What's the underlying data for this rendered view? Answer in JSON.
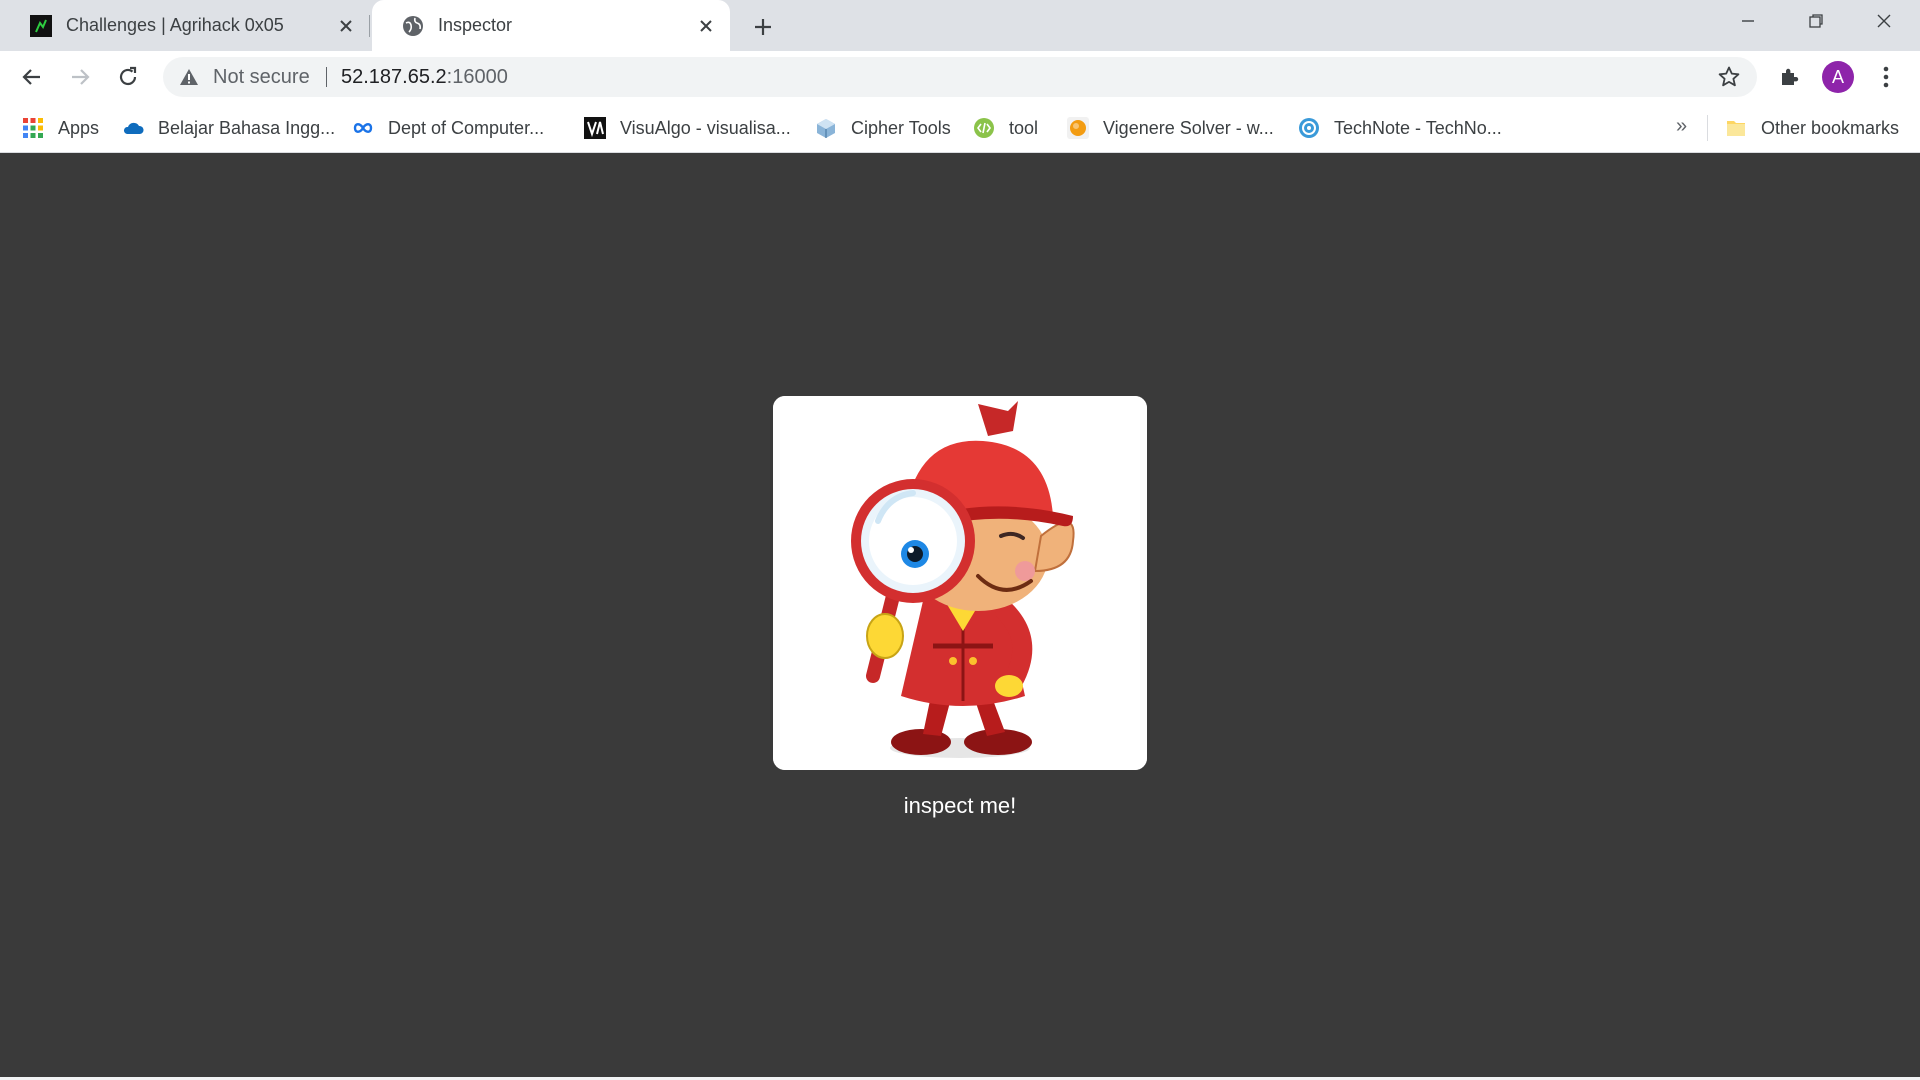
{
  "tabs": [
    {
      "title": "Challenges | Agrihack 0x05",
      "active": false,
      "icon": "agrihack-favicon"
    },
    {
      "title": "Inspector",
      "active": true,
      "icon": "globe-icon"
    }
  ],
  "toolbar": {
    "security_label": "Not secure",
    "url_host": "52.187.65.2",
    "url_port": ":16000",
    "avatar_letter": "A"
  },
  "bookmarks": {
    "items": [
      {
        "label": "Apps",
        "icon": "apps-grid-icon"
      },
      {
        "label": "Belajar Bahasa Ingg...",
        "icon": "cloud-icon"
      },
      {
        "label": "Dept of Computer...",
        "icon": "infinity-icon"
      },
      {
        "label": "VisuAlgo - visualisa...",
        "icon": "visualgo-icon"
      },
      {
        "label": "Cipher Tools",
        "icon": "cipher-icon"
      },
      {
        "label": "tool",
        "icon": "code-icon"
      },
      {
        "label": "Vigenere Solver - w...",
        "icon": "orange-circle-icon"
      },
      {
        "label": "TechNote - TechNo...",
        "icon": "technote-icon"
      }
    ],
    "overflow": "»",
    "other": "Other bookmarks"
  },
  "page": {
    "caption": "inspect me!",
    "image_alt": "cartoon detective with magnifying glass"
  },
  "colors": {
    "page_background": "#3a3a3a",
    "avatar": "#8e24aa",
    "tabstrip": "#dee1e6"
  }
}
